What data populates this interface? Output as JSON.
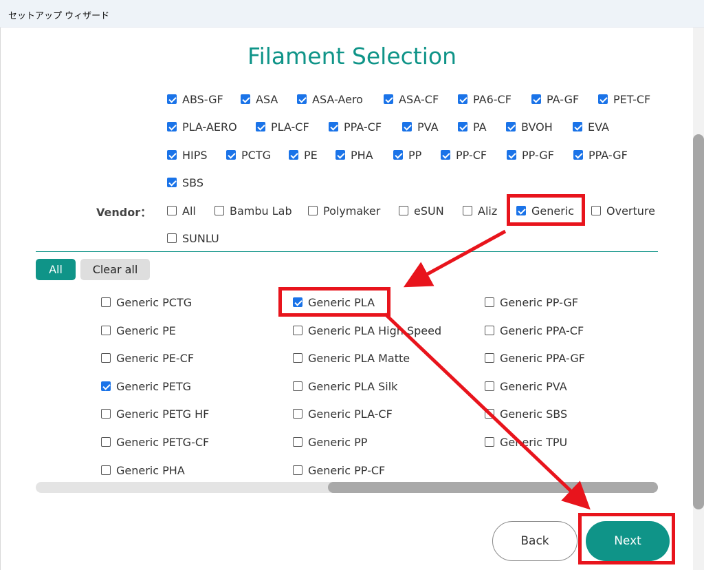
{
  "window": {
    "title": "セットアップ ウィザード"
  },
  "page_title": "Filament Selection",
  "type_filters": [
    {
      "label": "ABS-GF",
      "checked": true
    },
    {
      "label": "ASA",
      "checked": true
    },
    {
      "label": "ASA-Aero",
      "checked": true
    },
    {
      "label": "ASA-CF",
      "checked": true
    },
    {
      "label": "PA6-CF",
      "checked": true
    },
    {
      "label": "PA-GF",
      "checked": true
    },
    {
      "label": "PET-CF",
      "checked": true
    },
    {
      "label": "PLA-AERO",
      "checked": true
    },
    {
      "label": "PLA-CF",
      "checked": true
    },
    {
      "label": "PPA-CF",
      "checked": true
    },
    {
      "label": "PVA",
      "checked": true
    },
    {
      "label": "PA",
      "checked": true
    },
    {
      "label": "BVOH",
      "checked": true
    },
    {
      "label": "EVA",
      "checked": true
    },
    {
      "label": "HIPS",
      "checked": true
    },
    {
      "label": "PCTG",
      "checked": true
    },
    {
      "label": "PE",
      "checked": true
    },
    {
      "label": "PHA",
      "checked": true
    },
    {
      "label": "PP",
      "checked": true
    },
    {
      "label": "PP-CF",
      "checked": true
    },
    {
      "label": "PP-GF",
      "checked": true
    },
    {
      "label": "PPA-GF",
      "checked": true
    },
    {
      "label": "SBS",
      "checked": true
    }
  ],
  "vendor": {
    "label": "Vendor：",
    "options": [
      {
        "label": "All",
        "checked": false
      },
      {
        "label": "Bambu Lab",
        "checked": false
      },
      {
        "label": "Polymaker",
        "checked": false
      },
      {
        "label": "eSUN",
        "checked": false
      },
      {
        "label": "Aliz",
        "checked": false
      },
      {
        "label": "Generic",
        "checked": true
      },
      {
        "label": "Overture",
        "checked": false
      },
      {
        "label": "SUNLU",
        "checked": false
      }
    ]
  },
  "buttons": {
    "all": "All",
    "clear_all": "Clear all",
    "back": "Back",
    "next": "Next"
  },
  "filaments": [
    {
      "label": "Generic PCTG",
      "checked": false
    },
    {
      "label": "Generic PE",
      "checked": false
    },
    {
      "label": "Generic PE-CF",
      "checked": false
    },
    {
      "label": "Generic PETG",
      "checked": true
    },
    {
      "label": "Generic PETG HF",
      "checked": false
    },
    {
      "label": "Generic PETG-CF",
      "checked": false
    },
    {
      "label": "Generic PHA",
      "checked": false
    },
    {
      "label": "Generic PLA",
      "checked": true
    },
    {
      "label": "Generic PLA High Speed",
      "checked": false
    },
    {
      "label": "Generic PLA Matte",
      "checked": false
    },
    {
      "label": "Generic PLA Silk",
      "checked": false
    },
    {
      "label": "Generic PLA-CF",
      "checked": false
    },
    {
      "label": "Generic PP",
      "checked": false
    },
    {
      "label": "Generic PP-CF",
      "checked": false
    },
    {
      "label": "Generic PP-GF",
      "checked": false
    },
    {
      "label": "Generic PPA-CF",
      "checked": false
    },
    {
      "label": "Generic PPA-GF",
      "checked": false
    },
    {
      "label": "Generic PVA",
      "checked": false
    },
    {
      "label": "Generic SBS",
      "checked": false
    },
    {
      "label": "Generic TPU",
      "checked": false
    }
  ],
  "colors": {
    "accent": "#0f9488",
    "checkbox": "#1a73e8",
    "annotation": "#e8141c"
  }
}
